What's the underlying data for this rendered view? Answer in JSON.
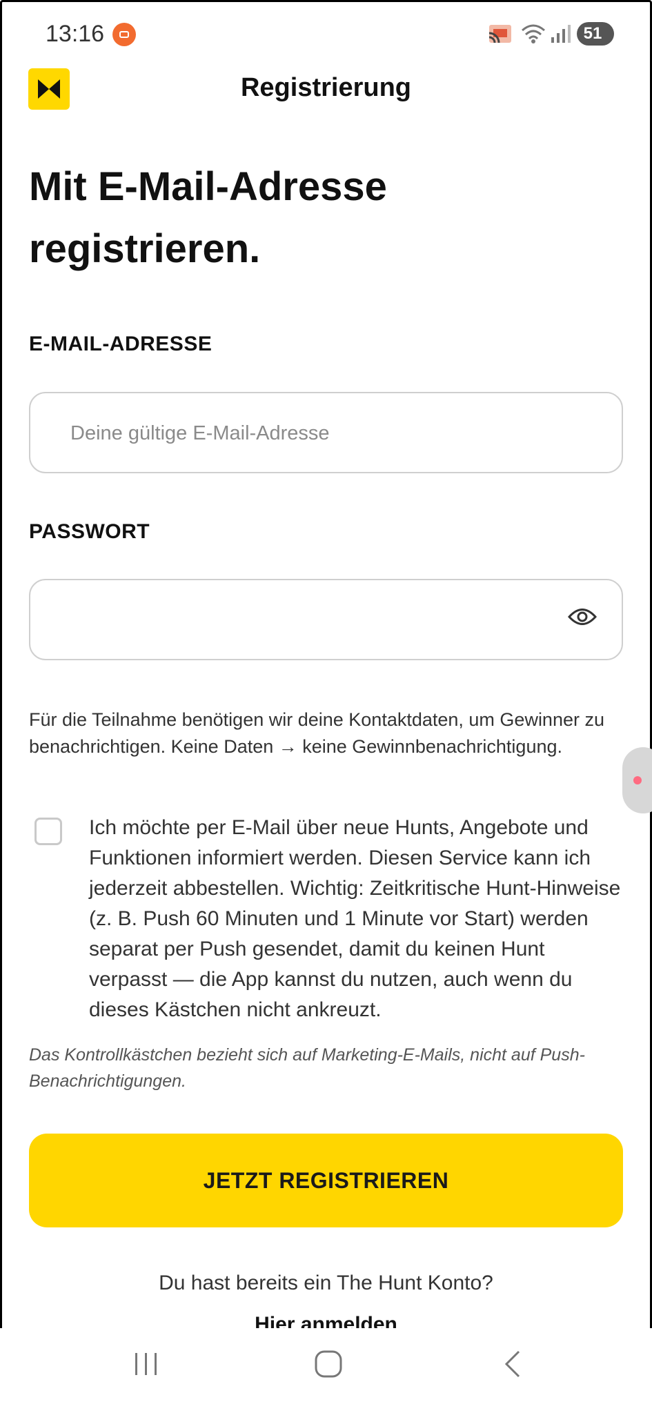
{
  "status_bar": {
    "time": "13:16",
    "battery": "51",
    "icons": [
      "screen-record-icon",
      "cast-icon",
      "wifi-icon",
      "signal-icon",
      "battery-icon"
    ]
  },
  "header": {
    "title": "Registrierung",
    "logo_color": "#ffd800"
  },
  "form": {
    "heading": "Mit E-Mail-Adresse registrieren.",
    "email_label": "E-MAIL-ADRESSE",
    "email_value": "",
    "email_placeholder": "Deine gültige E-Mail-Adresse",
    "password_label": "PASSWORT",
    "password_value": "",
    "info_text": "Für die Teilnahme benötigen wir deine Kontaktdaten, um Gewinner zu benachrichtigen. Keine Daten → keine Gewinnbenachrichtigung.",
    "consent_checked": false,
    "consent_text": "Ich möchte per E-Mail über neue Hunts, Angebote und Funktionen informiert werden. Diesen Service kann ich jederzeit abbestellen. Wichtig: Zeitkritische Hunt-Hinweise (z. B. Push 60 Minuten und 1 Minute vor Start) werden separat per Push gesendet, damit du keinen Hunt verpasst — die App kannst du nutzen, auch wenn du dieses Kästchen nicht ankreuzt.",
    "note_text": "Das Kontrollkästchen bezieht sich auf Marketing-E-Mails, nicht auf Push-Benachrichtigungen.",
    "register_button": "JETZT REGISTRIEREN",
    "login_question": "Du hast bereits ein The Hunt Konto?",
    "login_link": "Hier anmelden"
  },
  "colors": {
    "accent": "#ffd600",
    "text": "#111111"
  },
  "nav_bar": {
    "buttons": [
      "recent-apps-icon",
      "home-icon",
      "back-icon"
    ]
  }
}
